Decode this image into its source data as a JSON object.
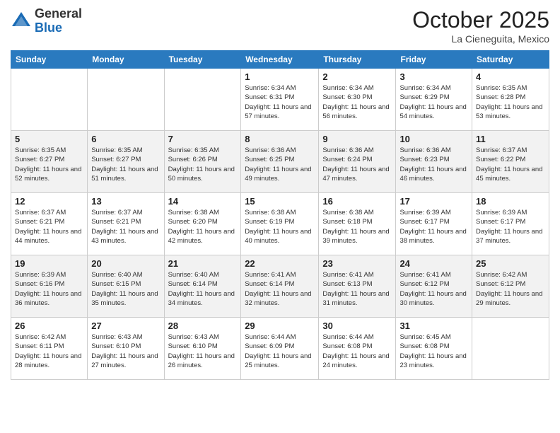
{
  "header": {
    "logo_line1": "General",
    "logo_line2": "Blue",
    "title": "October 2025",
    "subtitle": "La Cieneguita, Mexico"
  },
  "days_of_week": [
    "Sunday",
    "Monday",
    "Tuesday",
    "Wednesday",
    "Thursday",
    "Friday",
    "Saturday"
  ],
  "weeks": [
    [
      {
        "day": "",
        "info": ""
      },
      {
        "day": "",
        "info": ""
      },
      {
        "day": "",
        "info": ""
      },
      {
        "day": "1",
        "info": "Sunrise: 6:34 AM\nSunset: 6:31 PM\nDaylight: 11 hours\nand 57 minutes."
      },
      {
        "day": "2",
        "info": "Sunrise: 6:34 AM\nSunset: 6:30 PM\nDaylight: 11 hours\nand 56 minutes."
      },
      {
        "day": "3",
        "info": "Sunrise: 6:34 AM\nSunset: 6:29 PM\nDaylight: 11 hours\nand 54 minutes."
      },
      {
        "day": "4",
        "info": "Sunrise: 6:35 AM\nSunset: 6:28 PM\nDaylight: 11 hours\nand 53 minutes."
      }
    ],
    [
      {
        "day": "5",
        "info": "Sunrise: 6:35 AM\nSunset: 6:27 PM\nDaylight: 11 hours\nand 52 minutes."
      },
      {
        "day": "6",
        "info": "Sunrise: 6:35 AM\nSunset: 6:27 PM\nDaylight: 11 hours\nand 51 minutes."
      },
      {
        "day": "7",
        "info": "Sunrise: 6:35 AM\nSunset: 6:26 PM\nDaylight: 11 hours\nand 50 minutes."
      },
      {
        "day": "8",
        "info": "Sunrise: 6:36 AM\nSunset: 6:25 PM\nDaylight: 11 hours\nand 49 minutes."
      },
      {
        "day": "9",
        "info": "Sunrise: 6:36 AM\nSunset: 6:24 PM\nDaylight: 11 hours\nand 47 minutes."
      },
      {
        "day": "10",
        "info": "Sunrise: 6:36 AM\nSunset: 6:23 PM\nDaylight: 11 hours\nand 46 minutes."
      },
      {
        "day": "11",
        "info": "Sunrise: 6:37 AM\nSunset: 6:22 PM\nDaylight: 11 hours\nand 45 minutes."
      }
    ],
    [
      {
        "day": "12",
        "info": "Sunrise: 6:37 AM\nSunset: 6:21 PM\nDaylight: 11 hours\nand 44 minutes."
      },
      {
        "day": "13",
        "info": "Sunrise: 6:37 AM\nSunset: 6:21 PM\nDaylight: 11 hours\nand 43 minutes."
      },
      {
        "day": "14",
        "info": "Sunrise: 6:38 AM\nSunset: 6:20 PM\nDaylight: 11 hours\nand 42 minutes."
      },
      {
        "day": "15",
        "info": "Sunrise: 6:38 AM\nSunset: 6:19 PM\nDaylight: 11 hours\nand 40 minutes."
      },
      {
        "day": "16",
        "info": "Sunrise: 6:38 AM\nSunset: 6:18 PM\nDaylight: 11 hours\nand 39 minutes."
      },
      {
        "day": "17",
        "info": "Sunrise: 6:39 AM\nSunset: 6:17 PM\nDaylight: 11 hours\nand 38 minutes."
      },
      {
        "day": "18",
        "info": "Sunrise: 6:39 AM\nSunset: 6:17 PM\nDaylight: 11 hours\nand 37 minutes."
      }
    ],
    [
      {
        "day": "19",
        "info": "Sunrise: 6:39 AM\nSunset: 6:16 PM\nDaylight: 11 hours\nand 36 minutes."
      },
      {
        "day": "20",
        "info": "Sunrise: 6:40 AM\nSunset: 6:15 PM\nDaylight: 11 hours\nand 35 minutes."
      },
      {
        "day": "21",
        "info": "Sunrise: 6:40 AM\nSunset: 6:14 PM\nDaylight: 11 hours\nand 34 minutes."
      },
      {
        "day": "22",
        "info": "Sunrise: 6:41 AM\nSunset: 6:14 PM\nDaylight: 11 hours\nand 32 minutes."
      },
      {
        "day": "23",
        "info": "Sunrise: 6:41 AM\nSunset: 6:13 PM\nDaylight: 11 hours\nand 31 minutes."
      },
      {
        "day": "24",
        "info": "Sunrise: 6:41 AM\nSunset: 6:12 PM\nDaylight: 11 hours\nand 30 minutes."
      },
      {
        "day": "25",
        "info": "Sunrise: 6:42 AM\nSunset: 6:12 PM\nDaylight: 11 hours\nand 29 minutes."
      }
    ],
    [
      {
        "day": "26",
        "info": "Sunrise: 6:42 AM\nSunset: 6:11 PM\nDaylight: 11 hours\nand 28 minutes."
      },
      {
        "day": "27",
        "info": "Sunrise: 6:43 AM\nSunset: 6:10 PM\nDaylight: 11 hours\nand 27 minutes."
      },
      {
        "day": "28",
        "info": "Sunrise: 6:43 AM\nSunset: 6:10 PM\nDaylight: 11 hours\nand 26 minutes."
      },
      {
        "day": "29",
        "info": "Sunrise: 6:44 AM\nSunset: 6:09 PM\nDaylight: 11 hours\nand 25 minutes."
      },
      {
        "day": "30",
        "info": "Sunrise: 6:44 AM\nSunset: 6:08 PM\nDaylight: 11 hours\nand 24 minutes."
      },
      {
        "day": "31",
        "info": "Sunrise: 6:45 AM\nSunset: 6:08 PM\nDaylight: 11 hours\nand 23 minutes."
      },
      {
        "day": "",
        "info": ""
      }
    ]
  ]
}
